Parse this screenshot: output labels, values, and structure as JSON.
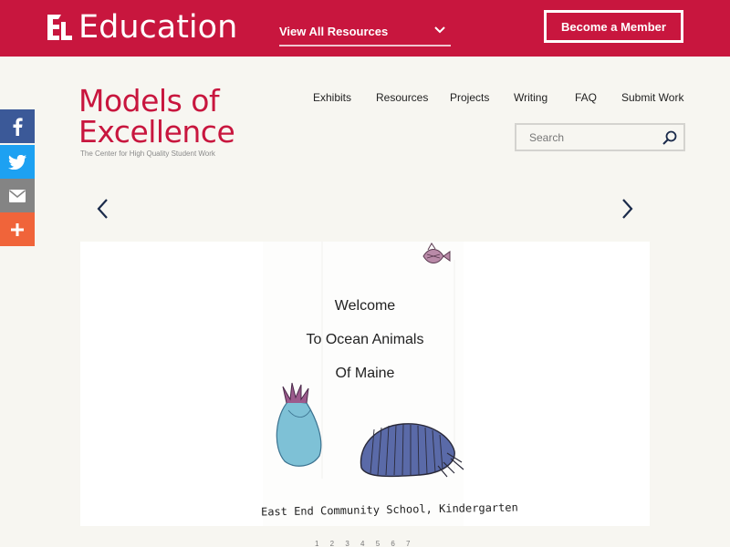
{
  "topbar": {
    "brand_text": "Education",
    "brand_mark": "EL",
    "view_all_label": "View All Resources",
    "member_button": "Become a Member",
    "color": "#c8163e"
  },
  "header": {
    "title_line1": "Models of",
    "title_line2": "Excellence",
    "subtitle": "The Center for High Quality Student Work"
  },
  "nav": {
    "items": [
      {
        "label": "Exhibits"
      },
      {
        "label": "Resources"
      },
      {
        "label": "Projects"
      },
      {
        "label": "Writing"
      },
      {
        "label": "FAQ"
      },
      {
        "label": "Submit Work"
      }
    ]
  },
  "search": {
    "placeholder": "Search",
    "icon": "search-icon"
  },
  "social": {
    "items": [
      {
        "icon": "facebook-icon",
        "color": "#3b5998"
      },
      {
        "icon": "twitter-icon",
        "color": "#1da1f2"
      },
      {
        "icon": "email-icon",
        "color": "#848484"
      },
      {
        "icon": "share-plus-icon",
        "color": "#f0643a"
      }
    ]
  },
  "slide": {
    "line1": "Welcome",
    "line2": "To Ocean Animals",
    "line3": "Of  Maine",
    "caption": "East End Community School, Kindergarten"
  },
  "pagination": {
    "text": "1  2  3  4  5  6  7"
  }
}
